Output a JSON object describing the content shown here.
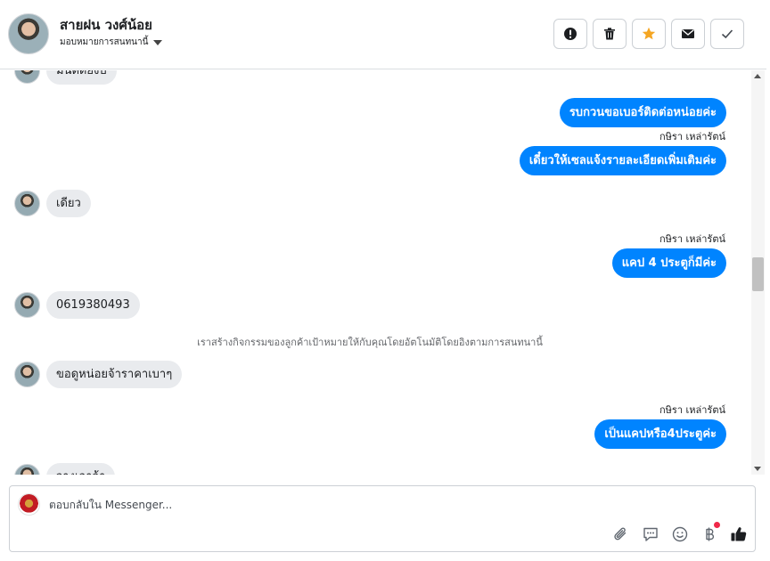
{
  "header": {
    "contact_name": "สายฝน วงศ์น้อย",
    "assign_label": "มอบหมายการสนทนานี้",
    "actions": [
      {
        "name": "spam-button",
        "icon": "alert-icon"
      },
      {
        "name": "delete-button",
        "icon": "trash-icon"
      },
      {
        "name": "star-button",
        "icon": "star-icon",
        "color": "#f5a623"
      },
      {
        "name": "mark-unread-button",
        "icon": "envelope-icon"
      },
      {
        "name": "done-button",
        "icon": "check-icon"
      }
    ]
  },
  "messages": {
    "partial_top": "มันติดยังป",
    "m1": "รบกวนขอเบอร์ติดต่อหน่อยค่ะ",
    "sender1": "กษิรา เหล่ารัตน์",
    "m2": "เดี๋ยวให้เซลแจ้งรายละเอียดเพิ่มเติมค่ะ",
    "m3": "เดียว",
    "sender2": "กษิรา เหล่ารัตน์",
    "m4": "แคป 4 ประตูก็มีค่ะ",
    "m5": "0619380493",
    "system_note": "เราสร้างกิจกรรมของลูกค้าเป้าหมายให้กับคุณโดยอัตโนมัติโดยอิงตามการสนทนานี้",
    "m6": "ขอดูหน่อยจ้าราคาเบาๆ",
    "sender3": "กษิรา เหล่ารัตน์",
    "m7": "เป็นแคปหรือ4ประตูค่ะ",
    "partial_bottom": "วางเอาจ้า"
  },
  "composer": {
    "placeholder": "ตอบกลับใน Messenger..."
  },
  "colors": {
    "outgoing_bubble": "#0084ff",
    "incoming_bubble": "#e9ebee",
    "like_icon": "#1c1e21"
  }
}
